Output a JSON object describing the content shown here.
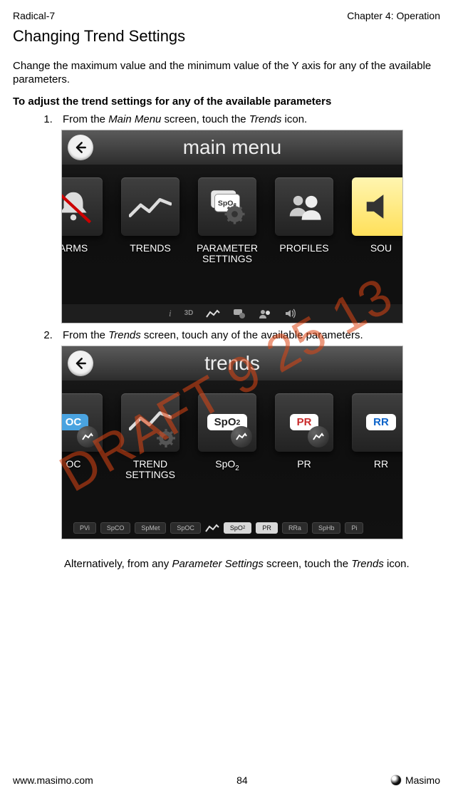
{
  "header": {
    "left": "Radical-7",
    "right": "Chapter 4: Operation"
  },
  "title": "Changing Trend Settings",
  "lead": "Change the maximum value and the minimum value of the Y axis for any of the available parameters.",
  "instruction_heading": "To adjust the trend settings for any of the available parameters",
  "steps": {
    "s1_pre": "From the ",
    "s1_em1": "Main Menu",
    "s1_mid": " screen, touch the ",
    "s1_em2": "Trends",
    "s1_post": " icon.",
    "s2_pre": "From the ",
    "s2_em1": "Trends",
    "s2_post": " screen, touch any of the available parameters."
  },
  "screens": {
    "main_menu": {
      "title": "main menu",
      "tiles": [
        "ARMS",
        "TRENDS",
        "PARAMETER\nSETTINGS",
        "PROFILES",
        "SOU"
      ],
      "toolbar_icons": [
        "i",
        "3D",
        "trends-icon",
        "param-icon",
        "profiles-icon",
        "sound-icon"
      ]
    },
    "trends": {
      "title": "trends",
      "tiles": [
        "OC",
        "TREND\nSETTINGS",
        "SpO₂",
        "PR",
        "RR"
      ],
      "pills": [
        "PVi",
        "SpCO",
        "SpMet",
        "SpOC",
        "SpO₂",
        "PR",
        "RRa",
        "SpHb",
        "Pi"
      ],
      "active_pills": [
        "SpO₂",
        "PR"
      ],
      "spo2_badge": "SpO₂",
      "pr_badge": "PR",
      "rr_badge": "RR"
    }
  },
  "alt_text": {
    "pre": "Alternatively, from any ",
    "em1": "Parameter Settings",
    "mid": " screen, touch the ",
    "em2": "Trends",
    "post": " icon."
  },
  "watermark": "DRAFT 9 25 13",
  "footer": {
    "left": "www.masimo.com",
    "center": "84",
    "right": "Masimo"
  }
}
